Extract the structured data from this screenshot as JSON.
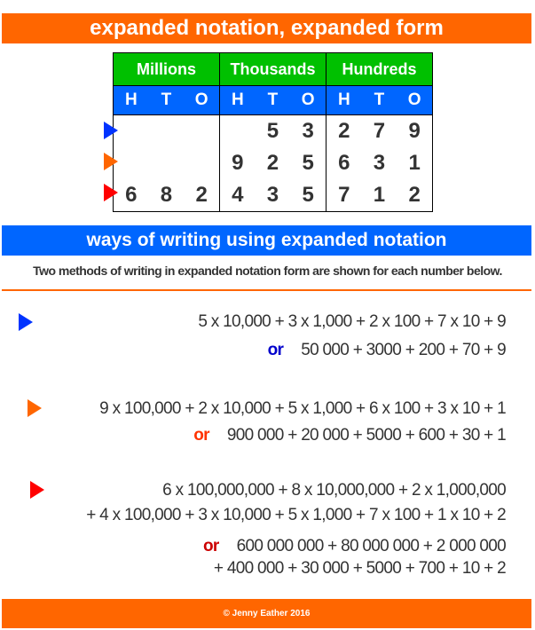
{
  "title": "expanded notation, expanded form",
  "table": {
    "groups": [
      "Millions",
      "Thousands",
      "Hundreds"
    ],
    "place_labels": [
      "H",
      "T",
      "O",
      "H",
      "T",
      "O",
      "H",
      "T",
      "O"
    ],
    "rows": [
      {
        "marker_color": "#0033FF",
        "digits": [
          "",
          "",
          "",
          "",
          "5",
          "3",
          "2",
          "7",
          "9"
        ]
      },
      {
        "marker_color": "#FF6600",
        "digits": [
          "",
          "",
          "",
          "9",
          "2",
          "5",
          "6",
          "3",
          "1"
        ]
      },
      {
        "marker_color": "#FF0000",
        "digits": [
          "6",
          "8",
          "2",
          "4",
          "3",
          "5",
          "7",
          "1",
          "2"
        ]
      }
    ]
  },
  "section_title": "ways of writing using expanded notation",
  "subtitle": "Two methods of writing in expanded notation form are shown for each number below.",
  "examples": [
    {
      "marker_color": "#0033FF",
      "method1": [
        "5 x 10,000 + 3 x 1,000 + 2 x 100 + 7 x 10 + 9"
      ],
      "or_label": "or",
      "or_color": "#0000CC",
      "method2": [
        "50 000 + 3000 + 200 + 70 + 9"
      ]
    },
    {
      "marker_color": "#FF6600",
      "method1": [
        "9 x 100,000 + 2 x 10,000 + 5 x 1,000 + 6 x 100 + 3 x 10 + 1"
      ],
      "or_label": "or",
      "or_color": "#FF3300",
      "method2": [
        "900 000 + 20 000 + 5000 + 600 + 30 + 1"
      ]
    },
    {
      "marker_color": "#FF0000",
      "method1": [
        "6 x 100,000,000 + 8 x 10,000,000 + 2 x 1,000,000",
        "+ 4 x 100,000 + 3 x 10,000 + 5 x 1,000 + 7 x 100 + 1 x 10 + 2"
      ],
      "or_label": "or",
      "or_color": "#CC0000",
      "method2": [
        "600 000 000 + 80 000 000 + 2 000 000",
        "+ 400 000 + 30 000 + 5000 + 700 + 10 + 2"
      ]
    }
  ],
  "footer": "© Jenny Eather 2016"
}
